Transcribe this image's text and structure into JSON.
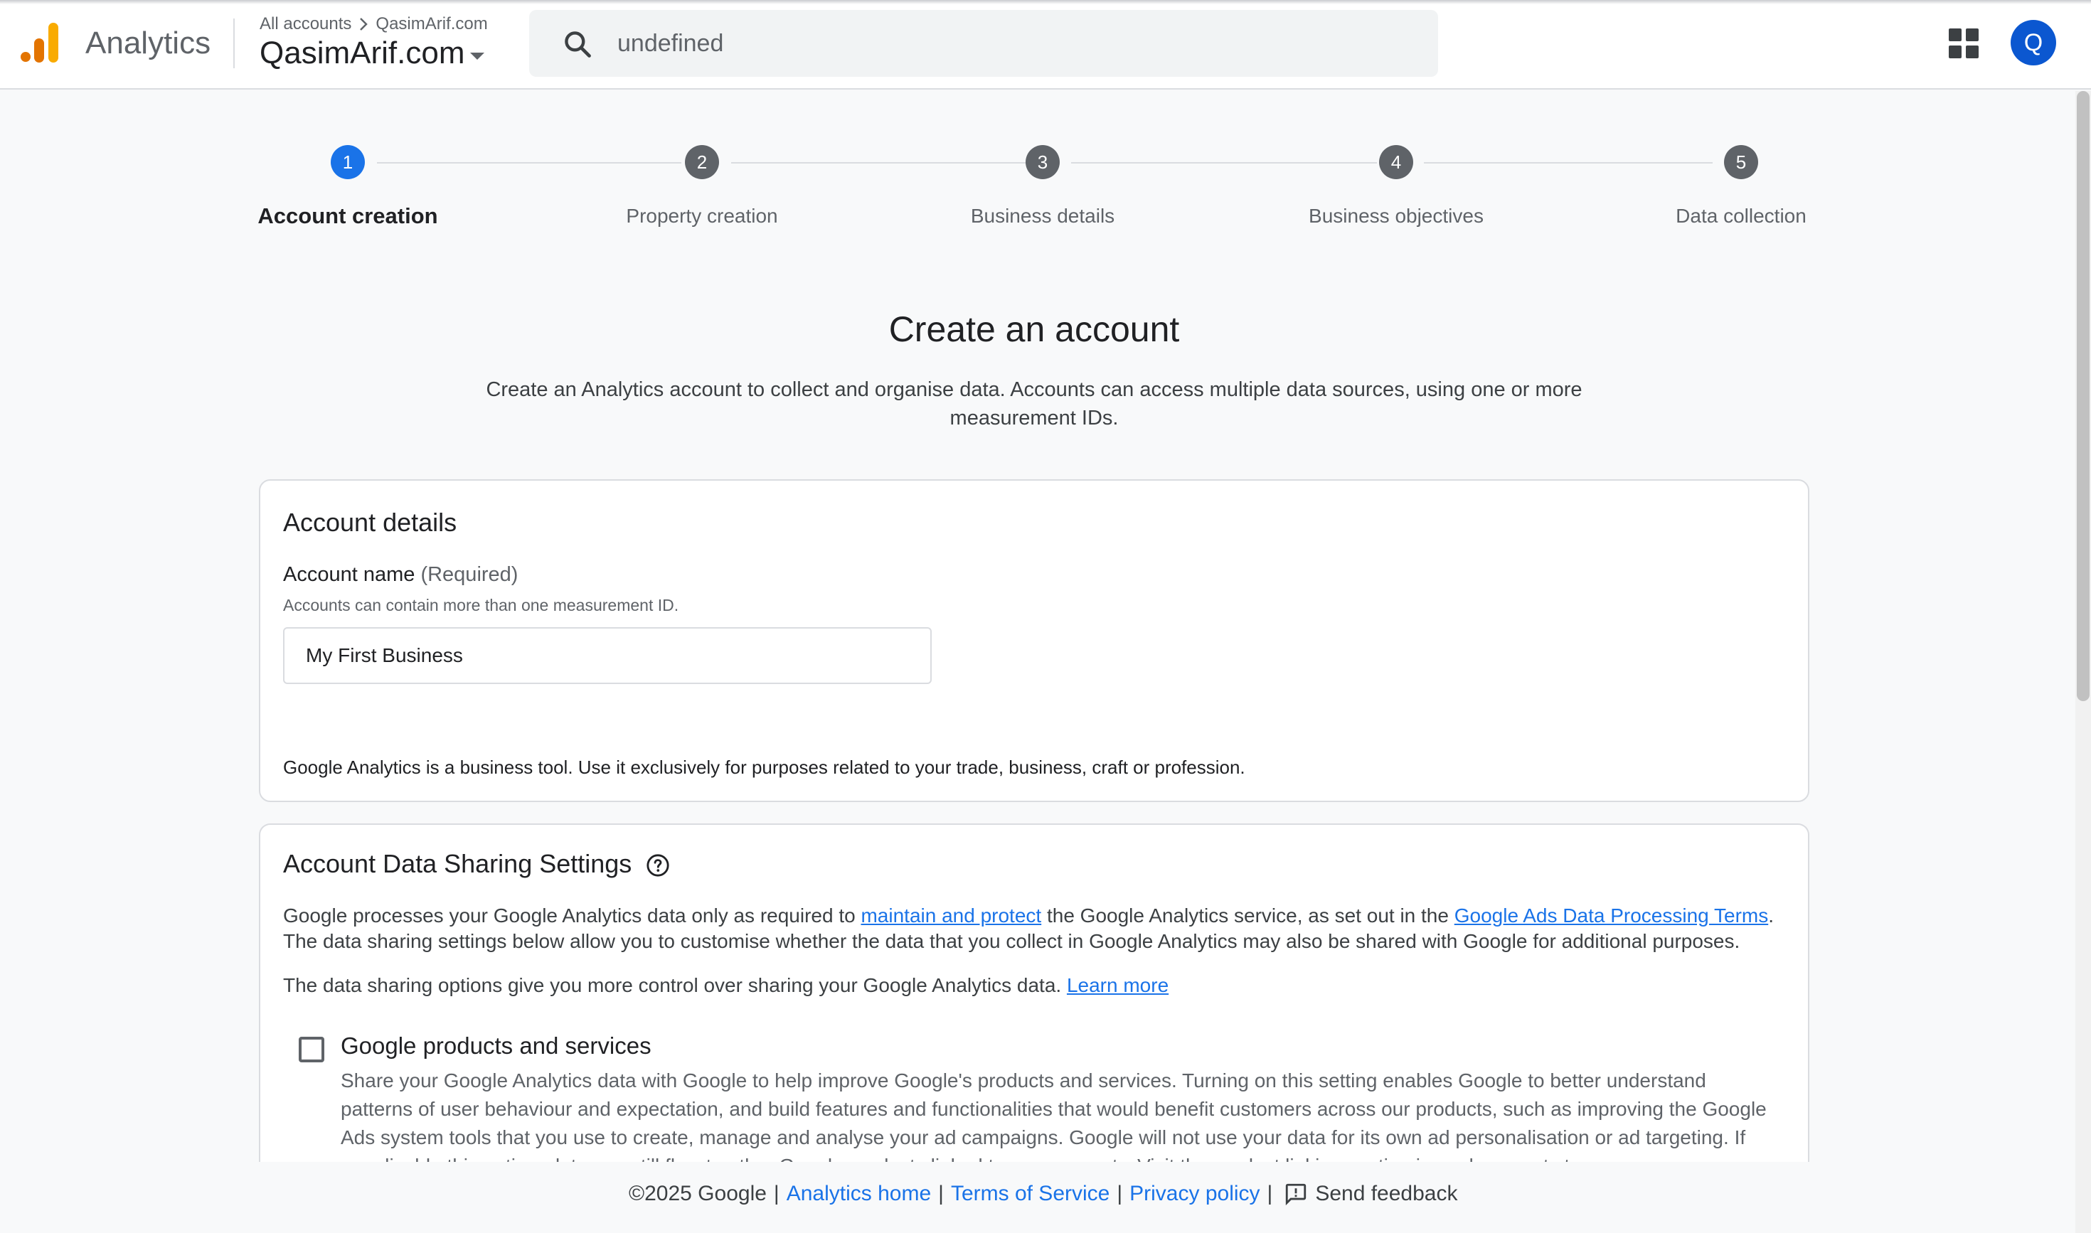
{
  "header": {
    "product_name": "Analytics",
    "breadcrumb_all": "All accounts",
    "breadcrumb_account": "QasimArif.com",
    "account_name": "QasimArif.com",
    "search_value": "undefined",
    "avatar_initial": "Q"
  },
  "stepper": {
    "steps": [
      {
        "number": "1",
        "label": "Account creation",
        "active": true
      },
      {
        "number": "2",
        "label": "Property creation",
        "active": false
      },
      {
        "number": "3",
        "label": "Business details",
        "active": false
      },
      {
        "number": "4",
        "label": "Business objectives",
        "active": false
      },
      {
        "number": "5",
        "label": "Data collection",
        "active": false
      }
    ]
  },
  "main": {
    "title": "Create an account",
    "subtitle": "Create an Analytics account to collect and organise data. Accounts can access multiple data sources, using one or more measurement IDs."
  },
  "account_details": {
    "title": "Account details",
    "field_label": "Account name",
    "field_required": "(Required)",
    "field_help": "Accounts can contain more than one measurement ID.",
    "field_value": "My First Business",
    "notice": "Google Analytics is a business tool. Use it exclusively for purposes related to your trade, business, craft or profession."
  },
  "data_sharing": {
    "title": "Account Data Sharing Settings",
    "para1_before": "Google processes your Google Analytics data only as required to ",
    "para1_link1": "maintain and protect",
    "para1_mid": " the Google Analytics service, as set out in the ",
    "para1_link2": "Google Ads Data Processing Terms",
    "para1_after": ". The data sharing settings below allow you to customise whether the data that you collect in Google Analytics may also be shared with Google for additional purposes.",
    "para2": "The data sharing options give you more control over sharing your Google Analytics data. ",
    "para2_link": "Learn more",
    "option_title": "Google products and services",
    "option_desc": "Share your Google Analytics data with Google to help improve Google's products and services. Turning on this setting enables Google to better understand patterns of user behaviour and expectation, and build features and functionalities that would benefit customers across our products, such as improving the Google Ads system tools that you use to create, manage and analyse your ad campaigns. Google will not use your data for its own ad personalisation or ad targeting. If you disable this option, data can still flow to other Google products linked to your property. Visit the product linking section in each property to"
  },
  "footer": {
    "copyright": "©2025 Google",
    "sep": "|",
    "link_home": "Analytics home",
    "link_terms": "Terms of Service",
    "link_privacy": "Privacy policy",
    "feedback": "Send feedback"
  },
  "colors": {
    "accent": "#1a73e8",
    "avatar": "#0b57d0",
    "logo_orange": "#f9ab00",
    "logo_dark_orange": "#e37400"
  }
}
